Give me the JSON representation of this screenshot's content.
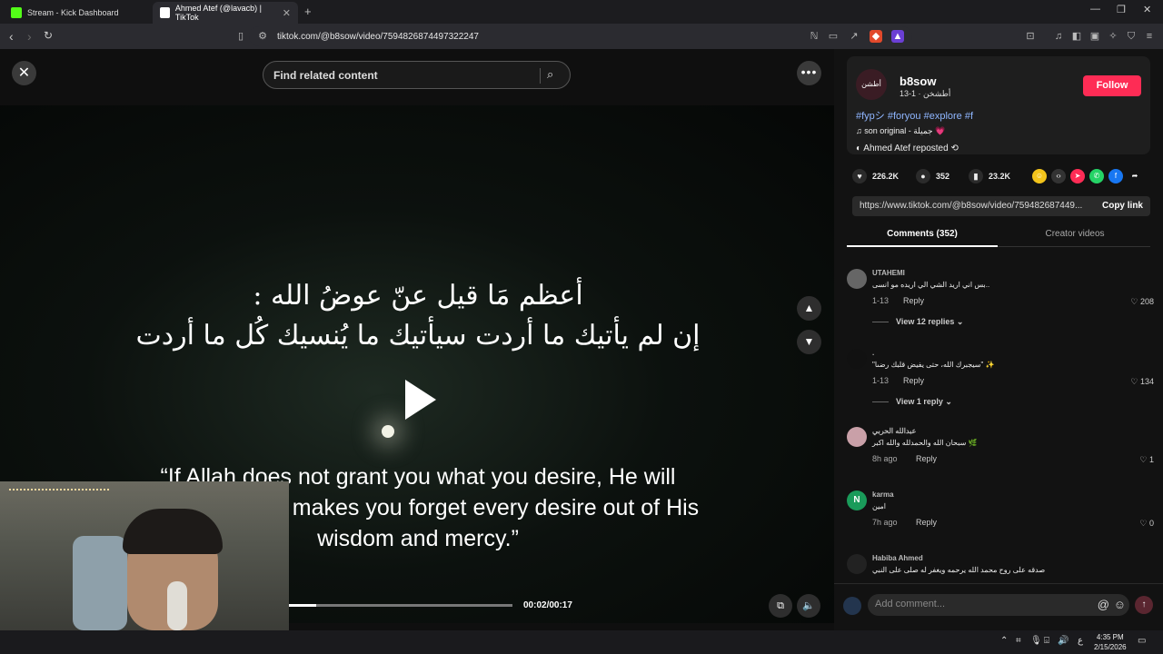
{
  "browser": {
    "tabs": [
      {
        "title": "Stream - Kick Dashboard",
        "active": false,
        "favicon_color": "#53fc18"
      },
      {
        "title": "Ahmed Atef (@lavacb) | TikTok",
        "active": true,
        "favicon_color": "#ffffff"
      }
    ],
    "url": "tiktok.com/@b8sow/video/7594826874497322247"
  },
  "player": {
    "search_placeholder": "Find related content",
    "arabic_line1": "أعظم مَا قيل عنّ عوضُ الله :",
    "arabic_line2": "إن لم يأتيك ما أردت سيأتيك ما يُنسيك كُل ما أردت",
    "quote": "“If Allah does not grant you what you desire, He will grant you what makes you forget every desire out of His wisdom and mercy.”",
    "time": "00:02/00:17",
    "progress": 0.12
  },
  "post": {
    "username": "b8sow",
    "avatar_text": "أطشن",
    "subline": "أطشخن · 1-13",
    "follow_label": "Follow",
    "tags": "#fypシ #foryou #explore #f",
    "sound": "son original - جميلة 💗",
    "repost": "Ahmed Atef reposted",
    "likes": "226.2K",
    "comments": "352",
    "saves": "23.2K",
    "link": "https://www.tiktok.com/@b8sow/video/759482687449...",
    "copy_label": "Copy link",
    "tab_comments": "Comments (352)",
    "tab_creator": "Creator videos"
  },
  "comments": [
    {
      "name": "UTAHEMI",
      "text": "بس اني اريد الشي الي اريده مو انسى..",
      "meta": "1-13",
      "reply": "Reply",
      "likes": "208",
      "view_replies": "View 12 replies",
      "avatar_color": "#666"
    },
    {
      "name": ".",
      "text": "\"سيجبرك الله، حتى يفيض قلبك رضىا\" ✨",
      "meta": "1-13",
      "reply": "Reply",
      "likes": "134",
      "view_replies": "View 1 reply",
      "avatar_color": "#111"
    },
    {
      "name": "عبدالله الحربي",
      "text": "سبحان الله والحمدلله والله اكبر 🌿",
      "meta": "8h ago",
      "reply": "Reply",
      "likes": "1",
      "view_replies": "",
      "avatar_color": "#c9a0a8"
    },
    {
      "name": "karma",
      "text": "امين",
      "meta": "7h ago",
      "reply": "Reply",
      "likes": "0",
      "view_replies": "",
      "avatar_color": "#1a9b5a",
      "avatar_letter": "N"
    },
    {
      "name": "Habiba Ahmed",
      "text": "صدقه على روح محمد الله يرحمه ويغفر له صلى على النبي",
      "meta": "",
      "reply": "",
      "likes": "",
      "view_replies": "",
      "avatar_color": "#222"
    }
  ],
  "add_comment_placeholder": "Add comment...",
  "taskbar": {
    "time": "4:35 PM",
    "date": "2/15/2026",
    "lang": "ع"
  }
}
